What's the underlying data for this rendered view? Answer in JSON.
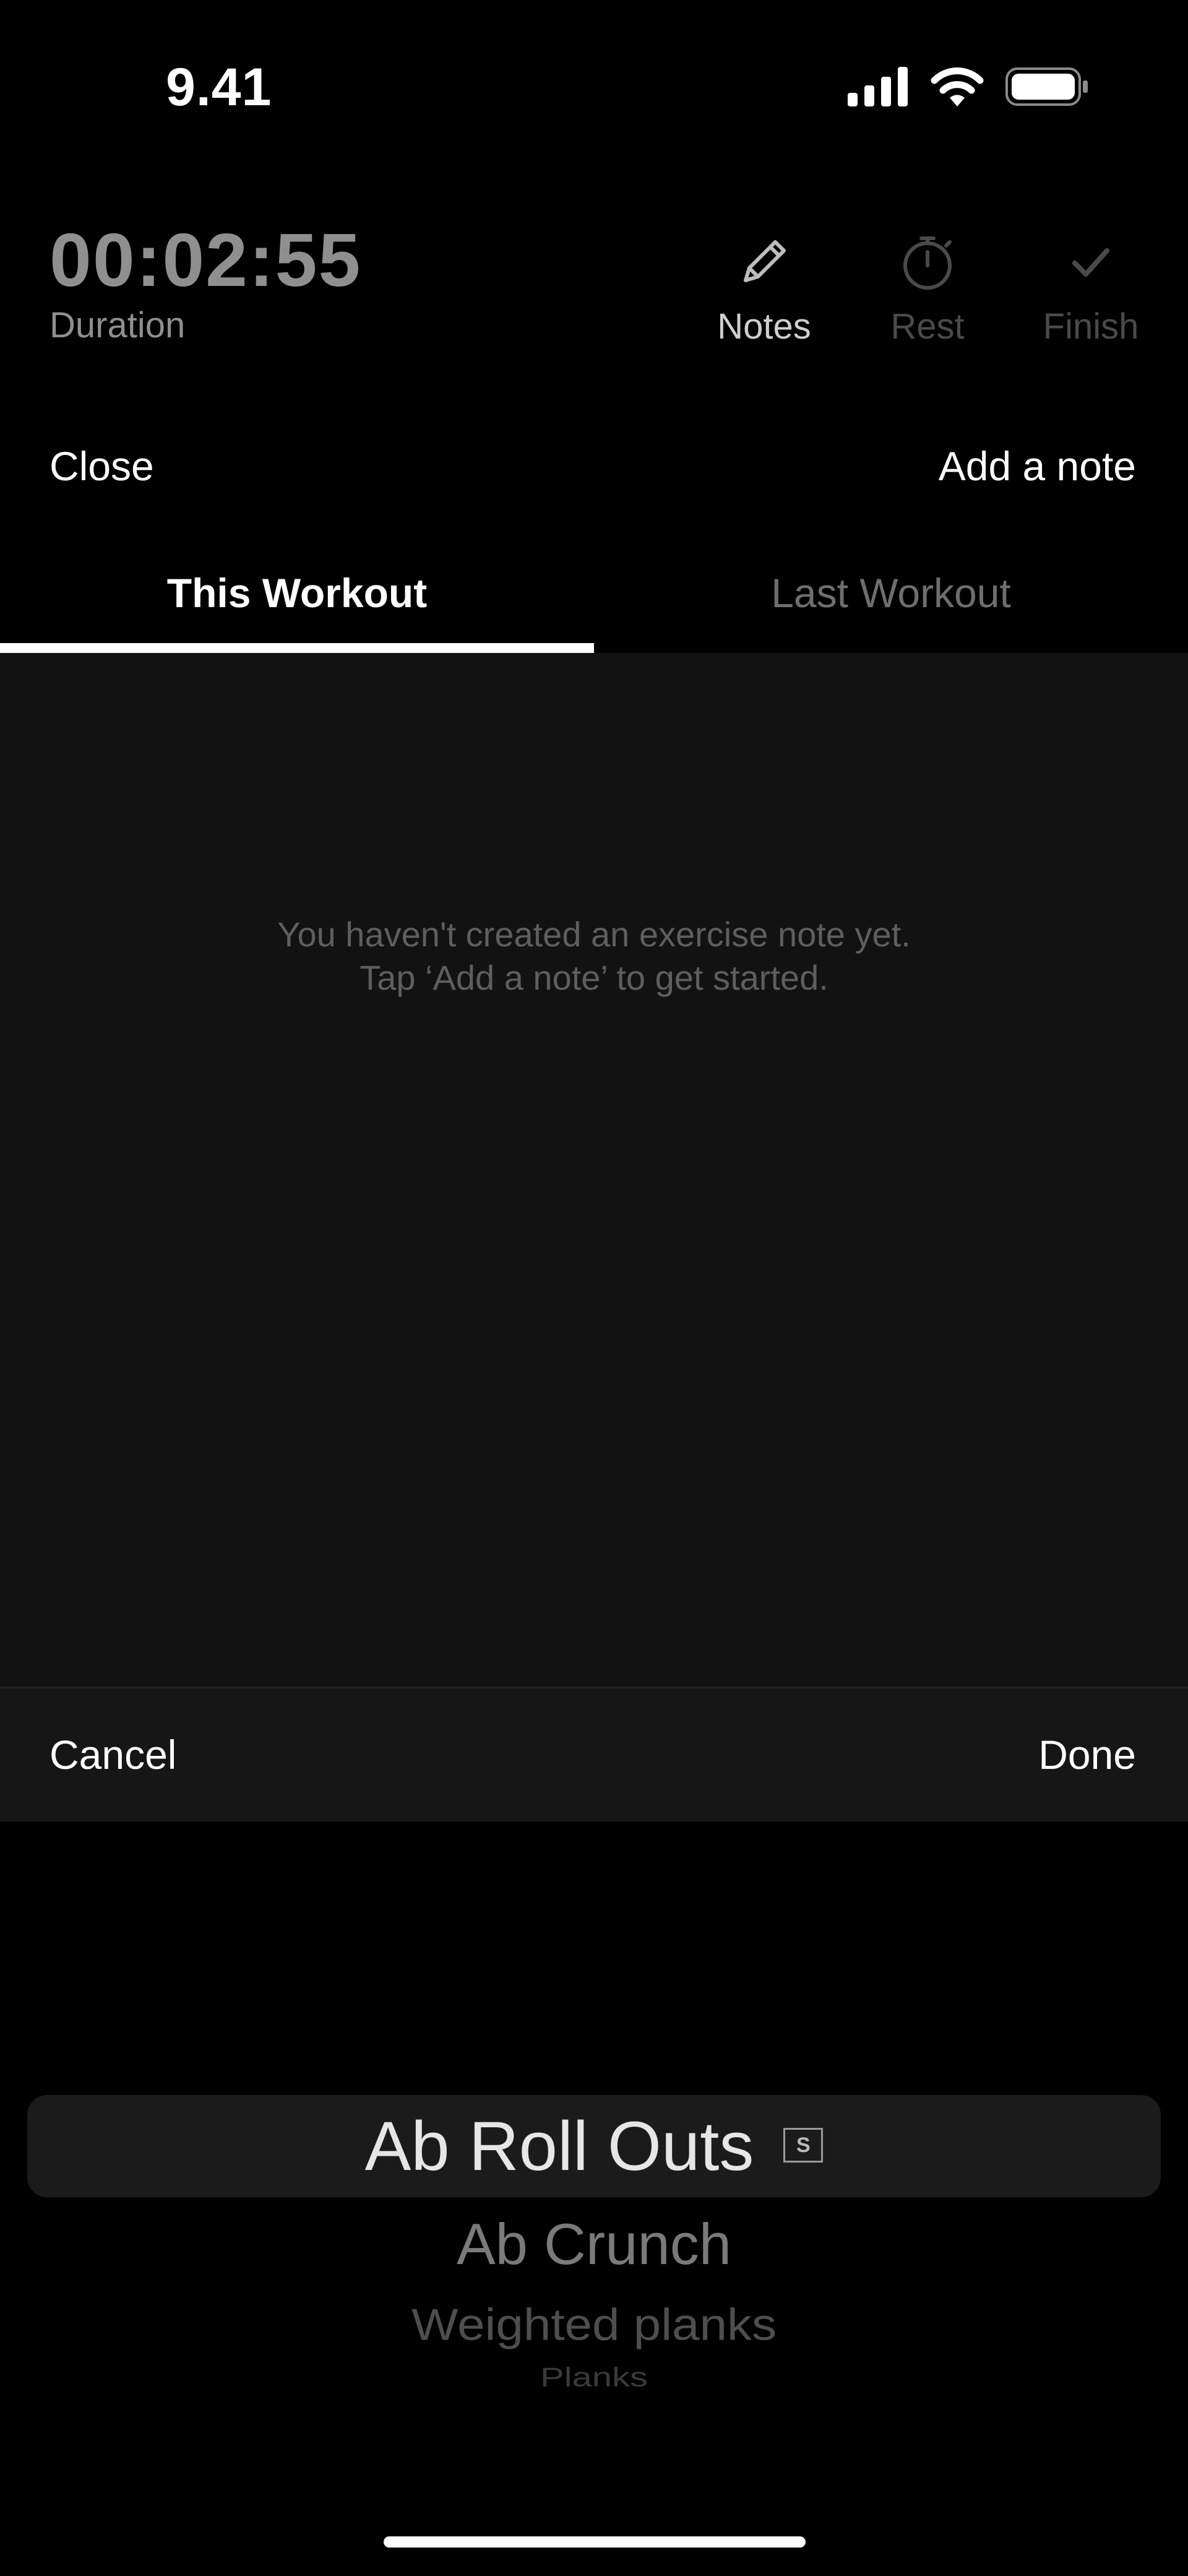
{
  "status_bar": {
    "time": "9.41",
    "icons": [
      "cellular-signal-icon",
      "wifi-icon",
      "battery-icon"
    ]
  },
  "workout": {
    "timer": "00:02:55",
    "timer_label": "Duration",
    "actions": [
      {
        "label": "Notes",
        "icon": "pencil-icon",
        "state": "active"
      },
      {
        "label": "Rest",
        "icon": "stopwatch-icon",
        "state": "disabled"
      },
      {
        "label": "Finish",
        "icon": "checkmark-icon",
        "state": "disabled"
      }
    ]
  },
  "notes_header": {
    "close_label": "Close",
    "add_note_label": "Add a note"
  },
  "tabs": [
    {
      "label": "This Workout",
      "selected": true
    },
    {
      "label": "Last Workout",
      "selected": false
    }
  ],
  "empty_state": {
    "line1": "You haven't created an exercise note yet.",
    "line2": "Tap ‘Add a note’ to get started."
  },
  "picker_toolbar": {
    "cancel_label": "Cancel",
    "done_label": "Done"
  },
  "picker": {
    "selected": "Ab Roll Outs",
    "selected_badge": "S",
    "items": [
      "Ab Roll Outs",
      "Ab Crunch",
      "Weighted planks",
      "Planks"
    ]
  },
  "colors": {
    "background": "#000000",
    "panel": "#121212",
    "toolbar": "#161616",
    "muted_text": "#8f8f8f",
    "disabled_text": "#4a4a4a"
  }
}
